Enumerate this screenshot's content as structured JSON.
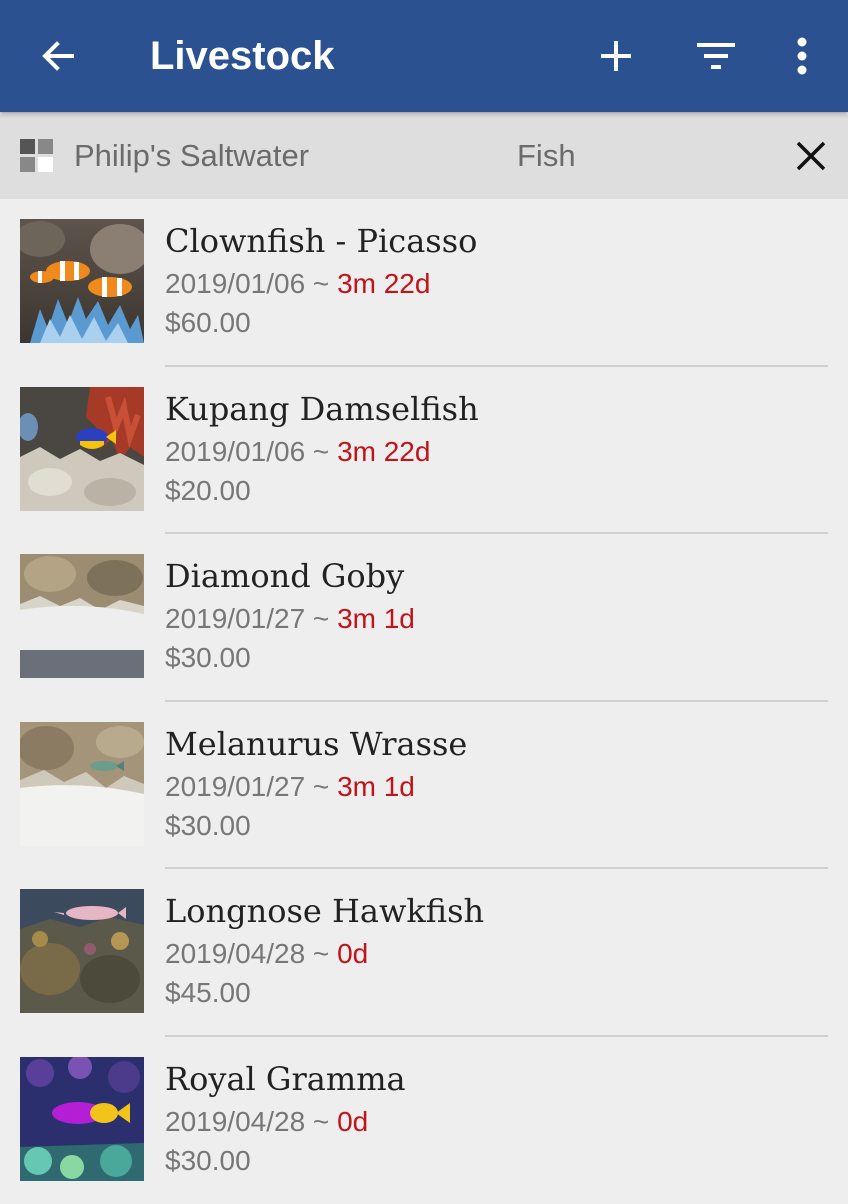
{
  "appbar": {
    "title": "Livestock",
    "icons": [
      "back-arrow-icon",
      "add-icon",
      "filter-icon",
      "more-vert-icon"
    ],
    "color": "#2c5190"
  },
  "subbar": {
    "tank_name": "Philip's Saltwater",
    "category": "Fish",
    "icons": [
      "tank-grid-icon",
      "close-icon"
    ]
  },
  "items": [
    {
      "name": "Clownfish - Picasso",
      "date": "2019/01/06",
      "sep": " ~ ",
      "age": "3m 22d",
      "price": "$60.00"
    },
    {
      "name": "Kupang Damselfish",
      "date": "2019/01/06",
      "sep": " ~ ",
      "age": "3m 22d",
      "price": "$20.00"
    },
    {
      "name": "Diamond Goby",
      "date": "2019/01/27",
      "sep": " ~ ",
      "age": "3m 1d",
      "price": "$30.00"
    },
    {
      "name": "Melanurus Wrasse",
      "date": "2019/01/27",
      "sep": " ~ ",
      "age": "3m 1d",
      "price": "$30.00"
    },
    {
      "name": "Longnose Hawkfish",
      "date": "2019/04/28",
      "sep": " ~ ",
      "age": "0d",
      "price": "$45.00"
    },
    {
      "name": "Royal Gramma",
      "date": "2019/04/28",
      "sep": " ~ ",
      "age": "0d",
      "price": "$30.00"
    }
  ],
  "colors": {
    "age_text": "#c0141a",
    "secondary_text": "#777777",
    "primary_text": "#222222"
  }
}
